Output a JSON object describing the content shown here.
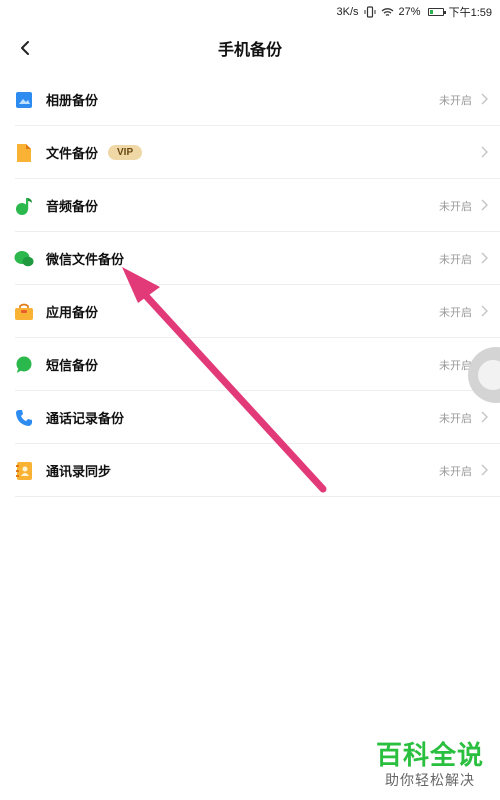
{
  "status_bar": {
    "speed": "3K/s",
    "battery_percent": "27%",
    "battery_level": 0.27,
    "time": "下午1:59"
  },
  "header": {
    "title": "手机备份",
    "back_icon": "back-chevron-icon"
  },
  "items": [
    {
      "label": "相册备份",
      "status": "未开启",
      "icon": "photo-album-icon",
      "color": "#2e8bf0"
    },
    {
      "label": "文件备份",
      "status": "",
      "badge": "VIP",
      "icon": "file-icon",
      "color": "#f9b233"
    },
    {
      "label": "音频备份",
      "status": "未开启",
      "icon": "music-note-icon",
      "color": "#2bb84c"
    },
    {
      "label": "微信文件备份",
      "status": "未开启",
      "icon": "wechat-icon",
      "color": "#2bb84c"
    },
    {
      "label": "应用备份",
      "status": "未开启",
      "icon": "app-bag-icon",
      "color": "#f9b233"
    },
    {
      "label": "短信备份",
      "status": "未开启",
      "icon": "sms-bubble-icon",
      "color": "#2bb84c"
    },
    {
      "label": "通话记录备份",
      "status": "未开启",
      "icon": "phone-icon",
      "color": "#2e8bf0"
    },
    {
      "label": "通讯录同步",
      "status": "未开启",
      "icon": "contacts-book-icon",
      "color": "#f9b233"
    }
  ],
  "watermark": {
    "title": "百科全说",
    "subtitle": "助你轻松解决"
  },
  "colors": {
    "arrow": "#e23a78",
    "accent_green": "#2bbf3f"
  }
}
